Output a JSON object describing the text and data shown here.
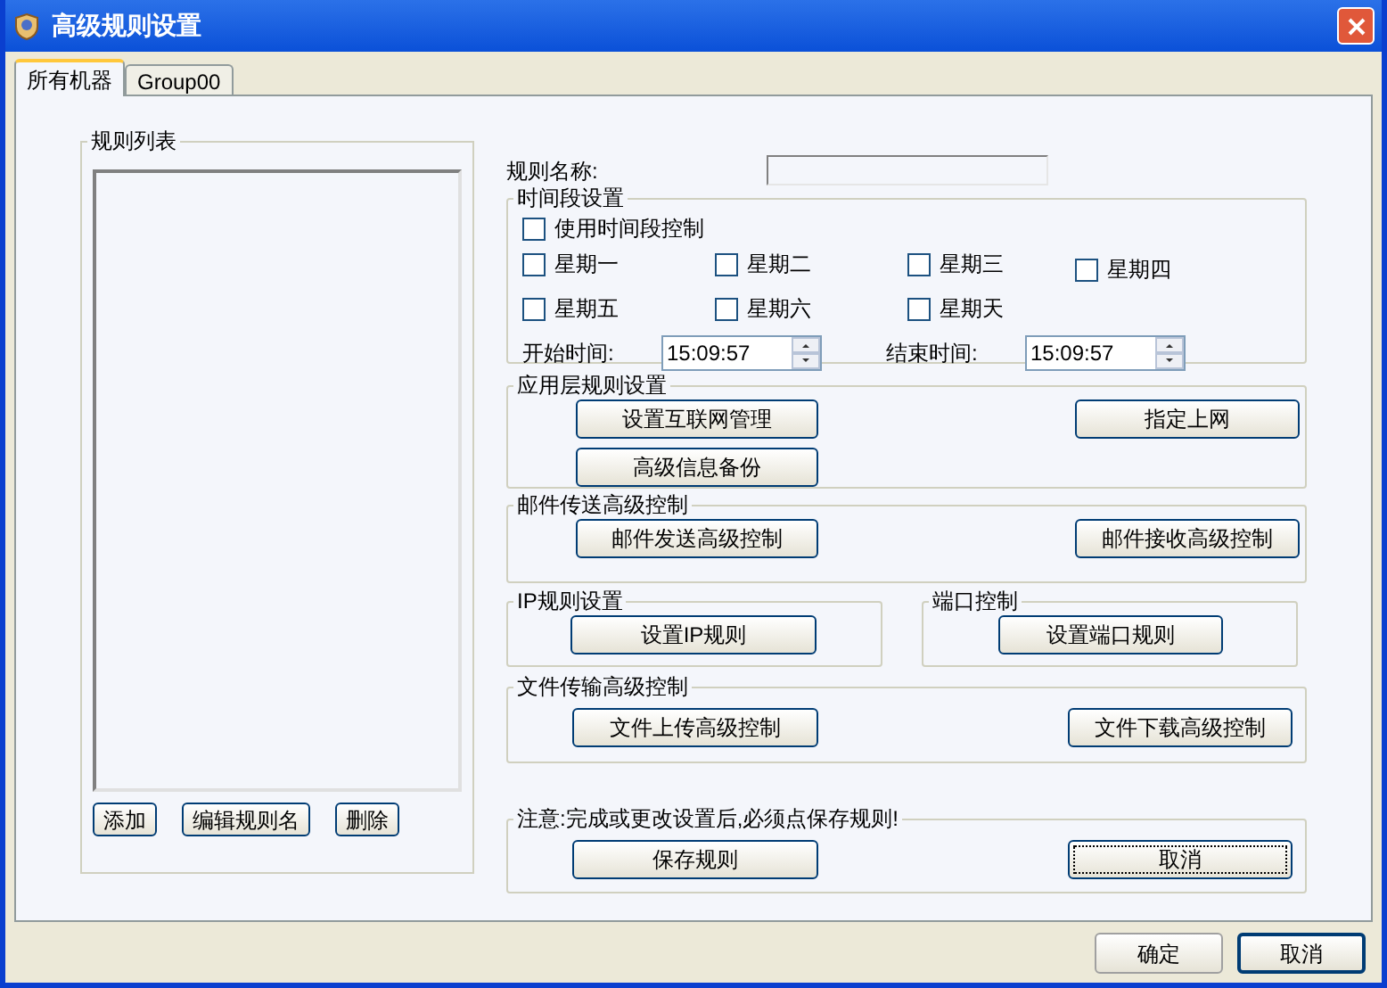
{
  "window": {
    "title": "高级规则设置"
  },
  "tabs": [
    {
      "label": "所有机器",
      "selected": true
    },
    {
      "label": "Group00",
      "selected": false
    }
  ],
  "rule_list": {
    "title": "规则列表",
    "buttons": [
      "添加",
      "编辑规则名",
      "删除"
    ]
  },
  "rule_name": {
    "label": "规则名称:"
  },
  "time_group": {
    "title": "时间段设置",
    "use_time": {
      "label": "使用时间段控制",
      "checked": false
    },
    "days": [
      {
        "label": "星期一",
        "checked": false
      },
      {
        "label": "星期二",
        "checked": false
      },
      {
        "label": "星期三",
        "checked": false
      },
      {
        "label": "星期四",
        "checked": false
      },
      {
        "label": "星期五",
        "checked": false
      },
      {
        "label": "星期六",
        "checked": false
      },
      {
        "label": "星期天",
        "checked": false
      }
    ],
    "start": {
      "label": "开始时间:",
      "value": "15:09:57"
    },
    "end": {
      "label": "结束时间:",
      "value": "15:09:57"
    }
  },
  "app_group": {
    "title": "应用层规则设置",
    "buttons": [
      {
        "label": "设置互联网管理",
        "focused": false
      },
      {
        "label": "指定上网",
        "focused": false
      },
      {
        "label": "高级信息备份",
        "focused": false
      }
    ]
  },
  "mail_group": {
    "title": "邮件传送高级控制",
    "buttons": [
      {
        "label": "邮件发送高级控制",
        "focused": false
      },
      {
        "label": "邮件接收高级控制",
        "focused": false
      }
    ]
  },
  "ip_group": {
    "title": "IP规则设置",
    "buttons": [
      {
        "label": "设置IP规则",
        "focused": false
      }
    ]
  },
  "port_group": {
    "title": "端口控制",
    "buttons": [
      {
        "label": "设置端口规则",
        "focused": false
      }
    ]
  },
  "file_group": {
    "title": "文件传输高级控制",
    "buttons": [
      {
        "label": "文件上传高级控制",
        "focused": false
      },
      {
        "label": "文件下载高级控制",
        "focused": false
      }
    ]
  },
  "note_group": {
    "title": "注意:完成或更改设置后,必须点保存规则!",
    "buttons": [
      {
        "label": "保存规则",
        "focused": false
      },
      {
        "label": "取消",
        "focused": true
      }
    ]
  },
  "dialog_buttons": [
    {
      "label": "确定",
      "default": false
    },
    {
      "label": "取消",
      "default": true
    }
  ]
}
